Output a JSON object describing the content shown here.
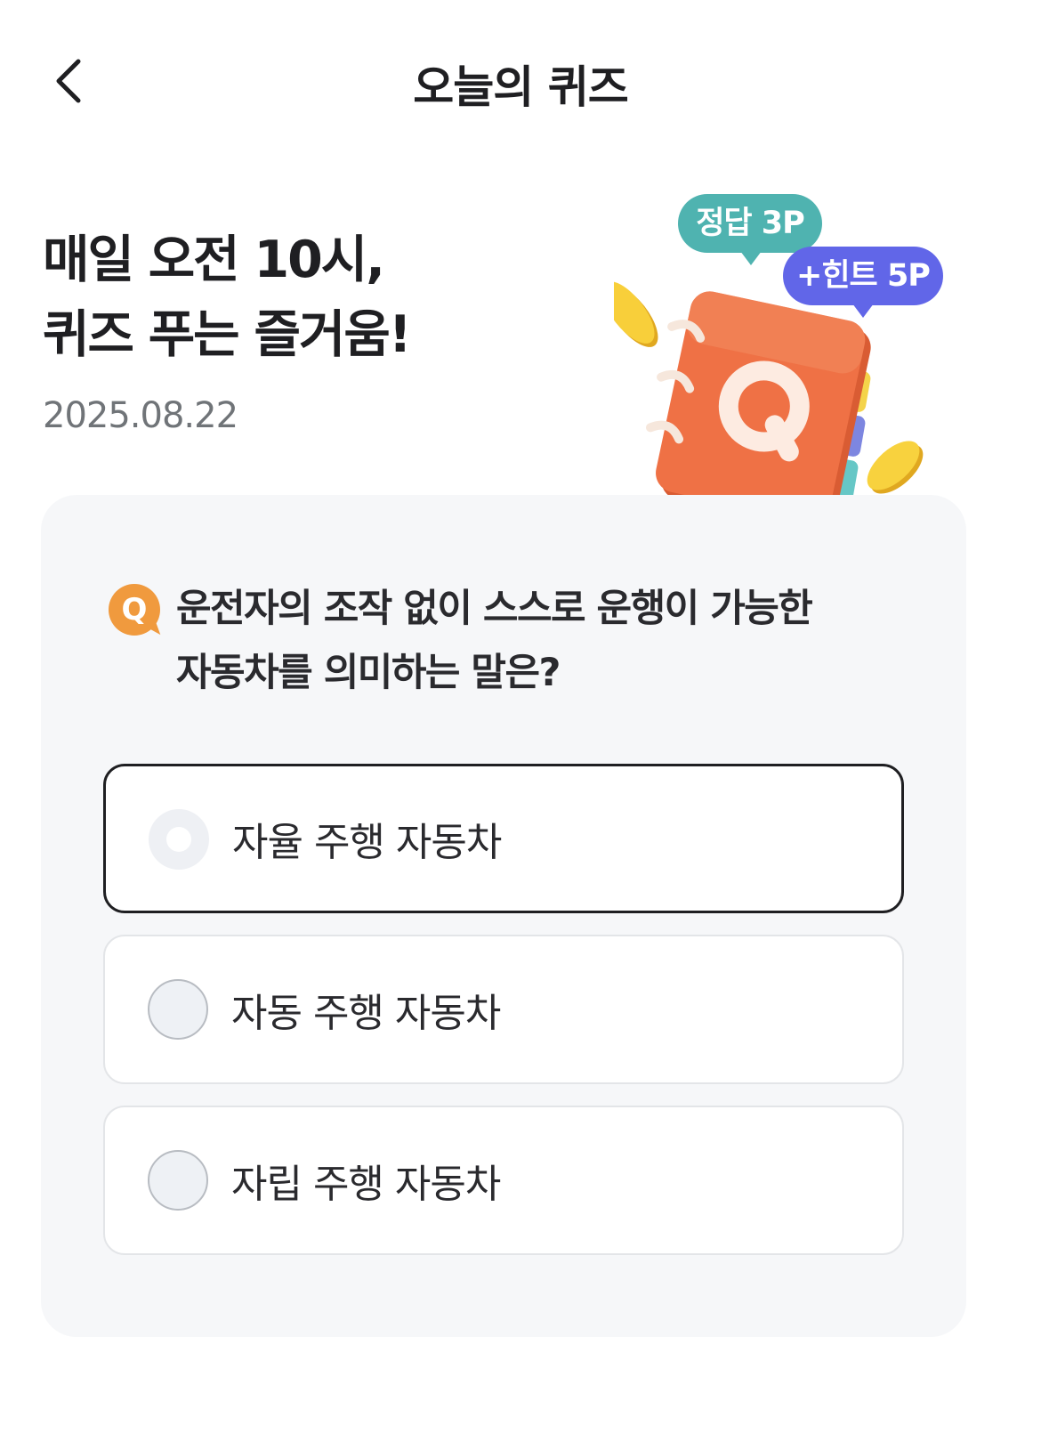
{
  "header": {
    "title": "오늘의 퀴즈",
    "back_icon": "chevron-left-icon"
  },
  "hero": {
    "line1": "매일 오전 10시,",
    "line2": "퀴즈 푸는 즐거움!",
    "date": "2025.08.22"
  },
  "illustration": {
    "answer_bubble": "정답 3P",
    "hint_bubble": "+힌트 5P",
    "book_letter": "Q"
  },
  "question": {
    "badge": "Q",
    "text_line1": "운전자의 조작 없이 스스로 운행이 가능한",
    "text_line2": "자동차를 의미하는 말은?"
  },
  "options": [
    {
      "label": "자율 주행 자동차",
      "selected": true
    },
    {
      "label": "자동 주행 자동차",
      "selected": false
    },
    {
      "label": "자립 주행 자동차",
      "selected": false
    }
  ],
  "colors": {
    "answer_bubble": "#4fb3b0",
    "hint_bubble": "#6166e8",
    "book": "#ef7145",
    "coin": "#f5c93a",
    "q_badge": "#f09a3e",
    "card_bg": "#f6f7f9"
  }
}
